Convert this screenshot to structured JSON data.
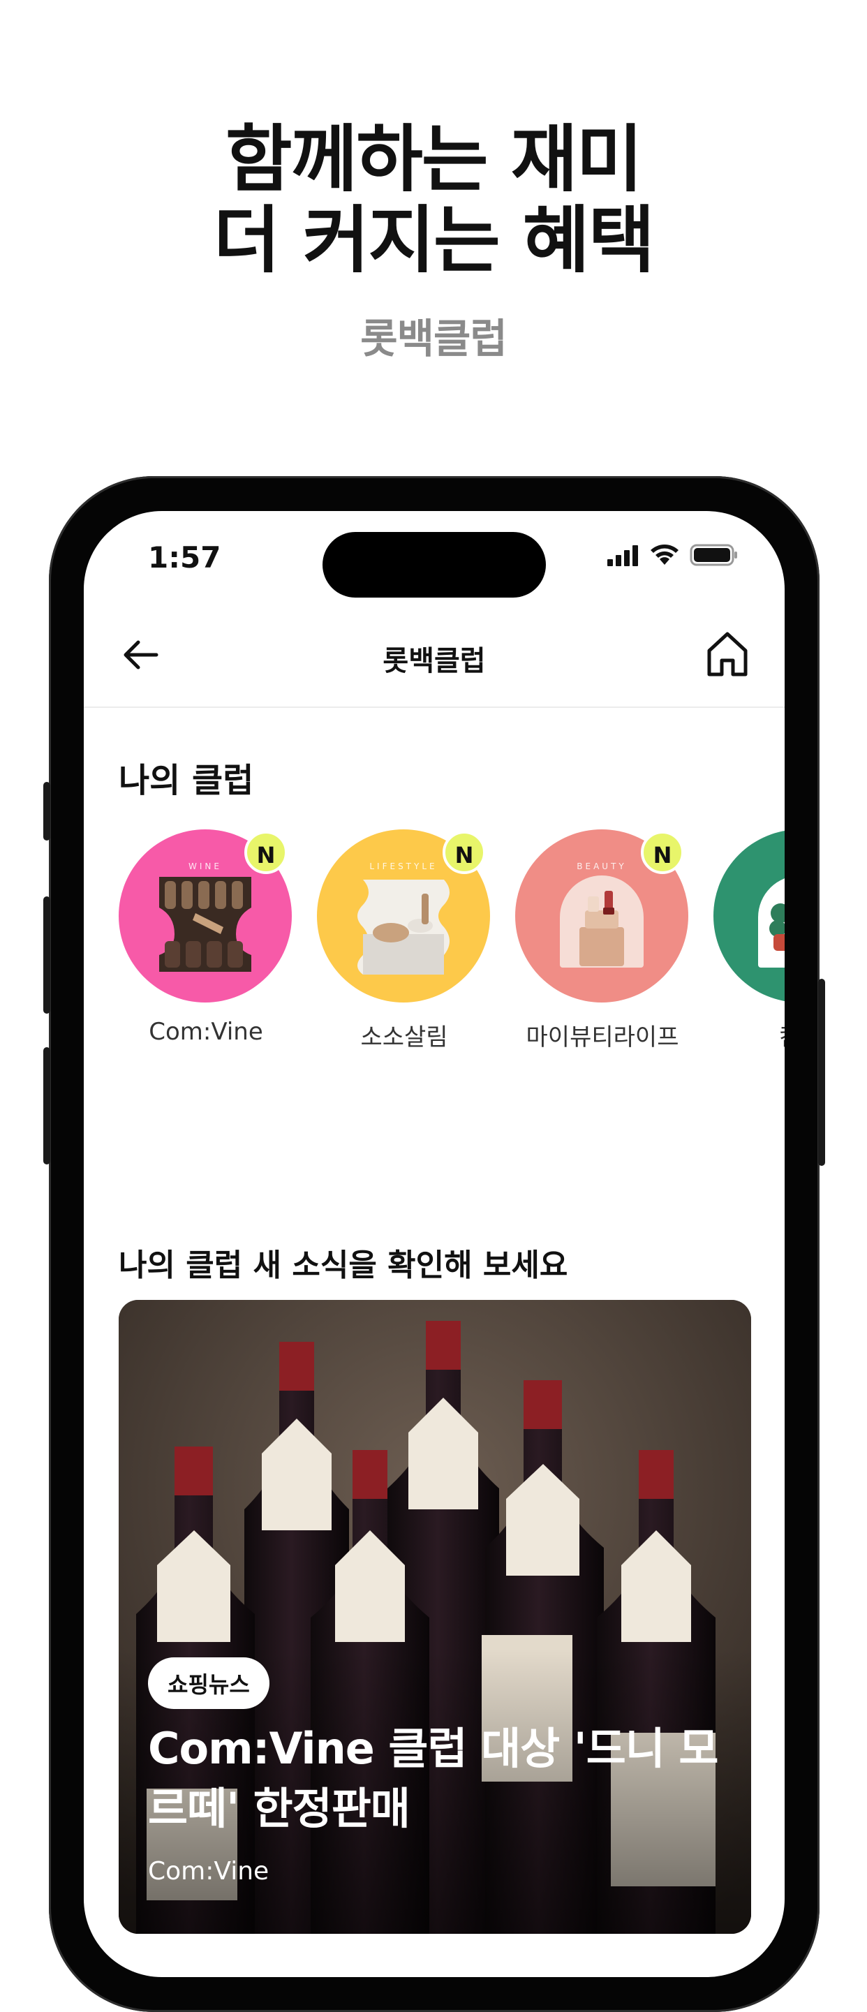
{
  "promo": {
    "headline_line1": "함께하는 재미",
    "headline_line2": "더 커지는 혜택",
    "subtitle": "롯백클럽"
  },
  "status_bar": {
    "time": "1:57"
  },
  "nav": {
    "title": "롯백클럽"
  },
  "my_clubs": {
    "title": "나의 클럽",
    "items": [
      {
        "name": "Com:Vine",
        "category": "WINE",
        "badge": "N",
        "color": "#f75aa8"
      },
      {
        "name": "소소살림",
        "category": "LIFESTYLE",
        "badge": "N",
        "color": "#fdc94a"
      },
      {
        "name": "마이뷰티라이프",
        "category": "BEAUTY",
        "badge": "N",
        "color": "#f08d86"
      },
      {
        "name": "킨더",
        "category": "",
        "badge": "",
        "color": "#2e936f"
      }
    ]
  },
  "news": {
    "title": "나의 클럽 새 소식을 확인해 보세요",
    "card": {
      "tag": "쇼핑뉴스",
      "headline": "Com:Vine 클럽 대상 '드니 모르떼' 한정판매",
      "source": "Com:Vine"
    }
  }
}
